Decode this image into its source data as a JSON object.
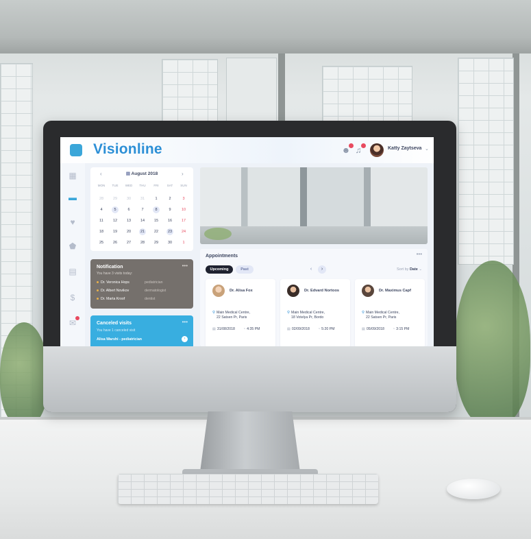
{
  "app": {
    "brand": "Visionline"
  },
  "header": {
    "user_name": "Katty Zaytseva",
    "user_menu_icon": "chevron-down-icon",
    "icons": [
      "users-icon",
      "bell-icon"
    ]
  },
  "sidebar": {
    "items": [
      {
        "icon": "grid-icon",
        "glyph": "▦",
        "active": false
      },
      {
        "icon": "folder-icon",
        "glyph": "▬",
        "active": true
      },
      {
        "icon": "heart-icon",
        "glyph": "♥",
        "active": false
      },
      {
        "icon": "shield-icon",
        "glyph": "⬟",
        "active": false
      },
      {
        "icon": "calendar-icon",
        "glyph": "▤",
        "active": false
      },
      {
        "icon": "currency-icon",
        "glyph": "$",
        "active": false
      },
      {
        "icon": "mail-icon",
        "glyph": "✉",
        "active": false
      }
    ]
  },
  "calendar": {
    "month_label": "August 2018",
    "prev": "‹",
    "next": "›",
    "weekdays": [
      "MON",
      "TUE",
      "WED",
      "THU",
      "FRI",
      "SAT",
      "SUN"
    ],
    "days": [
      {
        "d": "28",
        "muted": true
      },
      {
        "d": "29",
        "muted": true
      },
      {
        "d": "30",
        "muted": true
      },
      {
        "d": "31",
        "muted": true
      },
      {
        "d": "1"
      },
      {
        "d": "2"
      },
      {
        "d": "3",
        "red": true
      },
      {
        "d": "4"
      },
      {
        "d": "5",
        "hl": true
      },
      {
        "d": "6"
      },
      {
        "d": "7"
      },
      {
        "d": "8",
        "hl": true
      },
      {
        "d": "9"
      },
      {
        "d": "10",
        "red": true
      },
      {
        "d": "11"
      },
      {
        "d": "12"
      },
      {
        "d": "13"
      },
      {
        "d": "14"
      },
      {
        "d": "15"
      },
      {
        "d": "16"
      },
      {
        "d": "17",
        "red": true
      },
      {
        "d": "18"
      },
      {
        "d": "19"
      },
      {
        "d": "20"
      },
      {
        "d": "21",
        "hl": true
      },
      {
        "d": "22"
      },
      {
        "d": "23",
        "hl": true
      },
      {
        "d": "24",
        "red": true
      },
      {
        "d": "25"
      },
      {
        "d": "26"
      },
      {
        "d": "27"
      },
      {
        "d": "28"
      },
      {
        "d": "29"
      },
      {
        "d": "30"
      },
      {
        "d": "1",
        "red": true,
        "muted": true
      }
    ]
  },
  "notification": {
    "title": "Notification",
    "subtitle": "You have 3 visits today:",
    "items": [
      {
        "name": "Dr. Veronica Hops",
        "role": "pediatrician"
      },
      {
        "name": "Dr. Albert Novikov",
        "role": "dermatologist"
      },
      {
        "name": "Dr. Marta Kroof",
        "role": "dentist"
      }
    ],
    "more": "•••"
  },
  "canceled": {
    "title": "Canceled visits",
    "subtitle": "You have 1 canceled visit",
    "item": "Alisa Warshi - pediatrician",
    "more": "•••"
  },
  "appointments": {
    "title": "Appointments",
    "more": "•••",
    "tabs": {
      "upcoming": "Upcoming",
      "past": "Past"
    },
    "sort_label": "Sort by",
    "sort_value": "Date",
    "cards": [
      {
        "doctor": "Dr. Alisa Fox",
        "addr1": "Main Medical Centre,",
        "addr2": "22 Satsen Pr, Paris",
        "date": "31/08/2018",
        "time": "4:35 PM"
      },
      {
        "doctor": "Dr. Edvard Nortoos",
        "addr1": "Main Medical Centre,",
        "addr2": "18 Votelya Pr, Bordo",
        "date": "02/09/2018",
        "time": "5:20 PM"
      },
      {
        "doctor": "Dr. Maximus Capf",
        "addr1": "Main Medical Centre,",
        "addr2": "22 Satsen Pr, Paris",
        "date": "05/09/2018",
        "time": "3:15 PM"
      }
    ]
  },
  "colors": {
    "accent": "#2c8fd6",
    "canceled_bg": "#38aee0",
    "notification_bg": "#75706c",
    "badge": "#e84a5f"
  }
}
